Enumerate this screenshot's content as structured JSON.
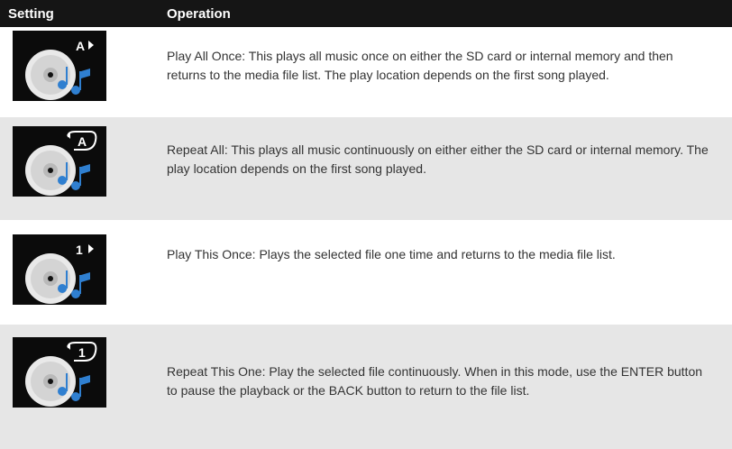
{
  "header": {
    "setting_label": "Setting",
    "operation_label": "Operation"
  },
  "rows": [
    {
      "icon": "play-all-once-icon",
      "mode_glyph": "A",
      "description": "Play All Once: This plays all music once on either the SD card or internal memory and then returns to the media file list. The play location depends on the first song played."
    },
    {
      "icon": "repeat-all-icon",
      "mode_glyph": "A",
      "description": "Repeat All: This plays all music continuously on either either the SD card or internal memory. The play location depends on the first song played."
    },
    {
      "icon": "play-this-once-icon",
      "mode_glyph": "1",
      "description": "Play This Once: Plays the selected file one time and returns to the media file list."
    },
    {
      "icon": "repeat-this-one-icon",
      "mode_glyph": "1",
      "description": "Repeat This One: Play the selected file continuously. When in this mode, use the ENTER button to pause the playback or the BACK button to return to the file list."
    }
  ],
  "colors": {
    "header_bg": "#151515",
    "row_shade": "#e6e6e6",
    "icon_bg": "#0b0b0b",
    "note_blue": "#2f7fd0"
  }
}
